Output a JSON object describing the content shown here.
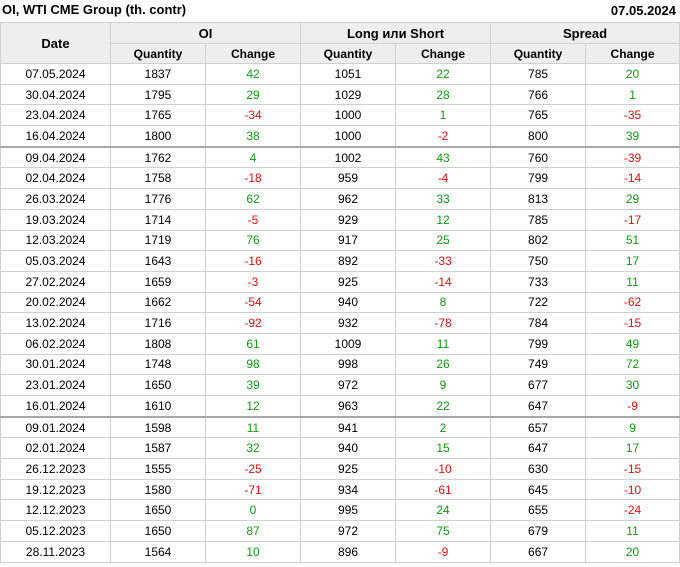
{
  "title": "OI, WTI CME Group (th. contr)",
  "date": "07.05.2024",
  "headers": {
    "date": "Date",
    "groups": [
      "OI",
      "Long или Short",
      "Spread"
    ],
    "sub": [
      "Quantity",
      "Change",
      "Quantity",
      "Change",
      "Quantity",
      "Change"
    ]
  },
  "colors": {
    "positive": "#119b11",
    "negative": "#e01010",
    "header_bg": "#eeeeee",
    "separator": "#a8a8a8"
  },
  "separator_after_rows": [
    3,
    16
  ],
  "rows": [
    [
      "07.05.2024",
      "1837",
      "42",
      "1051",
      "22",
      "785",
      "20"
    ],
    [
      "30.04.2024",
      "1795",
      "29",
      "1029",
      "28",
      "766",
      "1"
    ],
    [
      "23.04.2024",
      "1765",
      "-34",
      "1000",
      "1",
      "765",
      "-35"
    ],
    [
      "16.04.2024",
      "1800",
      "38",
      "1000",
      "-2",
      "800",
      "39"
    ],
    [
      "09.04.2024",
      "1762",
      "4",
      "1002",
      "43",
      "760",
      "-39"
    ],
    [
      "02.04.2024",
      "1758",
      "-18",
      "959",
      "-4",
      "799",
      "-14"
    ],
    [
      "26.03.2024",
      "1776",
      "62",
      "962",
      "33",
      "813",
      "29"
    ],
    [
      "19.03.2024",
      "1714",
      "-5",
      "929",
      "12",
      "785",
      "-17"
    ],
    [
      "12.03.2024",
      "1719",
      "76",
      "917",
      "25",
      "802",
      "51"
    ],
    [
      "05.03.2024",
      "1643",
      "-16",
      "892",
      "-33",
      "750",
      "17"
    ],
    [
      "27.02.2024",
      "1659",
      "-3",
      "925",
      "-14",
      "733",
      "11"
    ],
    [
      "20.02.2024",
      "1662",
      "-54",
      "940",
      "8",
      "722",
      "-62"
    ],
    [
      "13.02.2024",
      "1716",
      "-92",
      "932",
      "-78",
      "784",
      "-15"
    ],
    [
      "06.02.2024",
      "1808",
      "61",
      "1009",
      "11",
      "799",
      "49"
    ],
    [
      "30.01.2024",
      "1748",
      "98",
      "998",
      "26",
      "749",
      "72"
    ],
    [
      "23.01.2024",
      "1650",
      "39",
      "972",
      "9",
      "677",
      "30"
    ],
    [
      "16.01.2024",
      "1610",
      "12",
      "963",
      "22",
      "647",
      "-9"
    ],
    [
      "09.01.2024",
      "1598",
      "11",
      "941",
      "2",
      "657",
      "9"
    ],
    [
      "02.01.2024",
      "1587",
      "32",
      "940",
      "15",
      "647",
      "17"
    ],
    [
      "26.12.2023",
      "1555",
      "-25",
      "925",
      "-10",
      "630",
      "-15"
    ],
    [
      "19.12.2023",
      "1580",
      "-71",
      "934",
      "-61",
      "645",
      "-10"
    ],
    [
      "12.12.2023",
      "1650",
      "0",
      "995",
      "24",
      "655",
      "-24"
    ],
    [
      "05.12.2023",
      "1650",
      "87",
      "972",
      "75",
      "679",
      "11"
    ],
    [
      "28.11.2023",
      "1564",
      "10",
      "896",
      "-9",
      "667",
      "20"
    ]
  ]
}
